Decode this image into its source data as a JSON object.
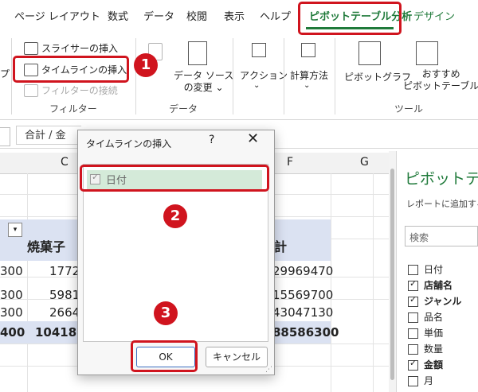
{
  "ribbon_tabs": [
    {
      "label": "ページ レイアウト"
    },
    {
      "label": "数式"
    },
    {
      "label": "データ"
    },
    {
      "label": "校閲"
    },
    {
      "label": "表示"
    },
    {
      "label": "ヘルプ"
    },
    {
      "label": "ピボットテーブル分析"
    },
    {
      "label": "デザイン"
    }
  ],
  "ribbon": {
    "partial_left": "プ",
    "filter": {
      "slicer_label": "スライサーの挿入",
      "timeline_label": "タイムラインの挿入",
      "filter_conn_label": "フィルターの接続",
      "group_label": "フィルター"
    },
    "data": {
      "change_source_label": "データ ソース\nの変更 ⌄",
      "group_label": "データ"
    },
    "action_label": "アクション",
    "calc_label": "計算方法",
    "tools": {
      "pivotchart_label": "ピボットグラフ",
      "recommended_label": "おすすめ\nピボットテーブル",
      "group_label": "ツール"
    }
  },
  "formula_bar": {
    "text": "合計 / 金"
  },
  "sheet": {
    "columns": [
      "C",
      "F",
      "G"
    ],
    "header_label": "焼菓子",
    "header_right": "計",
    "rows": [
      {
        "left": "300",
        "c": "1772",
        "f": "29969470"
      },
      {
        "left": "300",
        "c": "5981",
        "f": "15569700"
      },
      {
        "left": "300",
        "c": "2664",
        "f": "43047130"
      }
    ],
    "total": {
      "left": "400",
      "c": "10418",
      "f": "88586300"
    }
  },
  "pane": {
    "title": "ピボットテー",
    "subtitle": "レポートに追加する",
    "search_placeholder": "検索",
    "fields": [
      {
        "label": "日付",
        "checked": false,
        "bold": false
      },
      {
        "label": "店舗名",
        "checked": true,
        "bold": true
      },
      {
        "label": "ジャンル",
        "checked": true,
        "bold": true
      },
      {
        "label": "品名",
        "checked": false,
        "bold": false
      },
      {
        "label": "単価",
        "checked": false,
        "bold": false
      },
      {
        "label": "数量",
        "checked": false,
        "bold": false
      },
      {
        "label": "金額",
        "checked": true,
        "bold": true
      },
      {
        "label": "月",
        "checked": false,
        "bold": false
      }
    ]
  },
  "dialog": {
    "title": "タイムラインの挿入",
    "help": "?",
    "close": "✕",
    "items": [
      {
        "label": "日付",
        "checked": true
      }
    ],
    "ok_label": "OK",
    "cancel_label": "キャンセル"
  },
  "annotations": {
    "step1": "1",
    "step2": "2",
    "step3": "3",
    "color": "#d0141e"
  },
  "colors": {
    "accent_green": "#1f7a3a",
    "pivot_header": "#dbe2f2",
    "dialog_item_selected": "#d4ead9"
  }
}
